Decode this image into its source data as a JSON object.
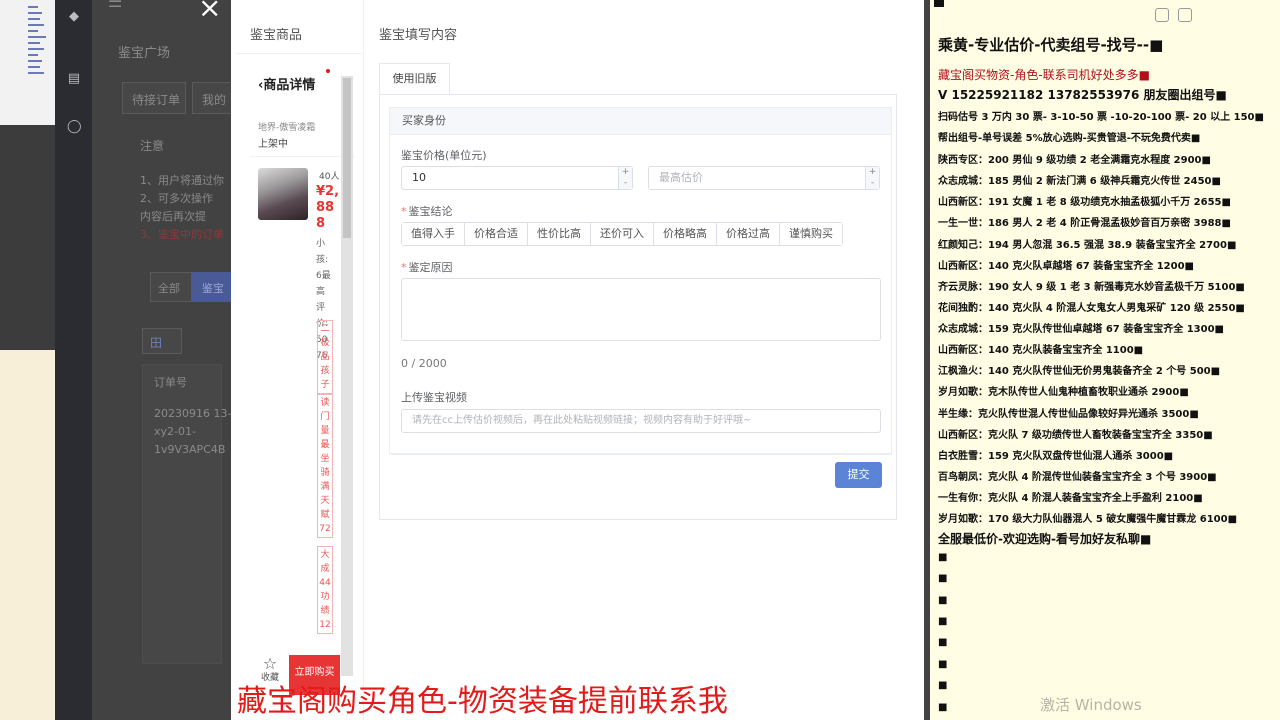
{
  "background_app": {
    "page_title": "鉴宝广场",
    "tab_pending": "待接订单",
    "tab_mine": "我的",
    "notice_title": "注意",
    "notice_1": "1、用户将通过你",
    "notice_2": "2、可多次操作",
    "notice_3": "内容后再次提",
    "notice_4": "3、鉴宝中的订单",
    "filter_all": "全部",
    "filter_other": "鉴宝",
    "view_select": "田",
    "column_order_no": "订单号",
    "order_line1": "20230916 13-",
    "order_line2": "xy2-01-",
    "order_line3": "1v9V3APC4B"
  },
  "modal": {
    "close_label": "×",
    "left_title": "鉴宝商品",
    "right_title": "鉴宝填写内容",
    "product": {
      "header": "商品详情",
      "region": "地界-傲雪凌霜",
      "status": "上架中",
      "count_text": "40人",
      "price": "¥2,888",
      "desc": "小孩:6最高评价:5076",
      "tags": [
        "二极品孩子",
        "读门量最坐骑满天赋72",
        "大成44功绩12"
      ],
      "favorite_label": "收藏",
      "buy_label": "立即购买"
    },
    "form": {
      "tab_label": "使用旧版",
      "section_title": "买家身份",
      "price_label": "鉴宝价格(单位元)",
      "price_value": "10",
      "max_placeholder": "最高估价",
      "conclusion_label": "鉴宝结论",
      "conclusion_options": [
        "值得入手",
        "价格合适",
        "性价比高",
        "还价可入",
        "价格略高",
        "价格过高",
        "谨慎购买"
      ],
      "reason_label": "鉴定原因",
      "reason_counter": "0 / 2000",
      "video_label": "上传鉴宝视频",
      "video_placeholder": "请先在cc上传估价视频后，再在此处粘贴视频链接；视频内容有助于好评哦~",
      "submit_label": "提交"
    }
  },
  "notepad": {
    "lines": [
      {
        "text": "乘黄-专业估价-代卖组号-找号--■",
        "style": "big"
      },
      {
        "text": "藏宝阁买物资-角色-联系司机好处多多■",
        "style": "mid red nm"
      },
      {
        "text": "V 15225921182   13782553976 朋友圈出组号■",
        "style": "mid"
      },
      {
        "text": "扫码估号 3 万内 30 票- 3-10-50 票  -10-20-100 票- 20 以上 150■",
        "style": "sm"
      },
      {
        "text": "帮出组号-单号误差 5%放心选购-买贵管退-不玩免费代卖■",
        "style": "sm"
      },
      {
        "text": "陕西专区：200 男仙 9 级功绩 2 老全满霜克水程度 2900■",
        "style": "sm"
      },
      {
        "text": "众志成城：185 男仙 2 新法门满 6 级神兵霜克火传世 2450■",
        "style": "sm"
      },
      {
        "text": "山西新区：191 女魔 1 老 8 级功绩克水抽孟极狐小千万 2655■",
        "style": "sm"
      },
      {
        "text": "一生一世：186 男人 2 老 4 阶正骨混孟极妙音百万亲密 3988■",
        "style": "sm"
      },
      {
        "text": "红颜知己：194 男人忽混 36.5 强混 38.9 装备宝宝齐全 2700■",
        "style": "sm"
      },
      {
        "text": "山西新区：140 克火队卓越塔 67 装备宝宝齐全 1200■",
        "style": "sm"
      },
      {
        "text": "齐云灵脉：190 女人 9 级 1 老 3 新强毒克水妙音孟极千万 5100■",
        "style": "sm"
      },
      {
        "text": "花间独酌：140 克火队 4 阶混人女鬼女人男鬼采矿 120 级 2550■",
        "style": "sm"
      },
      {
        "text": "众志成城：159 克火队传世仙卓越塔 67 装备宝宝齐全 1300■",
        "style": "sm"
      },
      {
        "text": "山西新区：140 克火队装备宝宝齐全 1100■",
        "style": "sm"
      },
      {
        "text": "江枫渔火：140 克火队传世仙无价男鬼装备齐全 2 个号 500■",
        "style": "sm"
      },
      {
        "text": "岁月如歌：克木队传世人仙鬼种植畜牧职业通杀 2900■",
        "style": "sm"
      },
      {
        "text": "半生缘：克火队传世混人传世仙品像较好异光通杀 3500■",
        "style": "sm"
      },
      {
        "text": "山西新区：克火队 7 级功绩传世人畜牧装备宝宝齐全 3350■",
        "style": "sm"
      },
      {
        "text": "白衣胜雪：159 克火队双盘传世仙混人通杀 3000■",
        "style": "sm"
      },
      {
        "text": "百鸟朝凤：克火队 4 阶混传世仙装备宝宝齐全 3 个号 3900■",
        "style": "sm"
      },
      {
        "text": "一生有你：克火队 4 阶混人装备宝宝齐全上手盈利 2100■",
        "style": "sm"
      },
      {
        "text": "岁月如歌：170 级大力队仙器混人 5 破女魔强牛魔甘霖龙 6100■",
        "style": "sm"
      },
      {
        "text": "全服最低价-欢迎选购-看号加好友私聊■",
        "style": "mid"
      },
      {
        "text": "■",
        "style": "sm"
      },
      {
        "text": "■",
        "style": "sm"
      },
      {
        "text": "■",
        "style": "sm"
      },
      {
        "text": "■",
        "style": "sm"
      },
      {
        "text": "■",
        "style": "sm"
      },
      {
        "text": "■",
        "style": "sm"
      },
      {
        "text": "■",
        "style": "sm"
      },
      {
        "text": "■",
        "style": "sm"
      }
    ]
  },
  "overlay": {
    "subtitle": "藏宝阁购买角色-物资装备提前联系我",
    "watermark": "激活 Windows"
  },
  "colors": {
    "accent_blue": "#5b83d6",
    "buy_red": "#e73535",
    "subtitle_red": "#e31a1a",
    "notepad_bg": "#fffde4"
  }
}
